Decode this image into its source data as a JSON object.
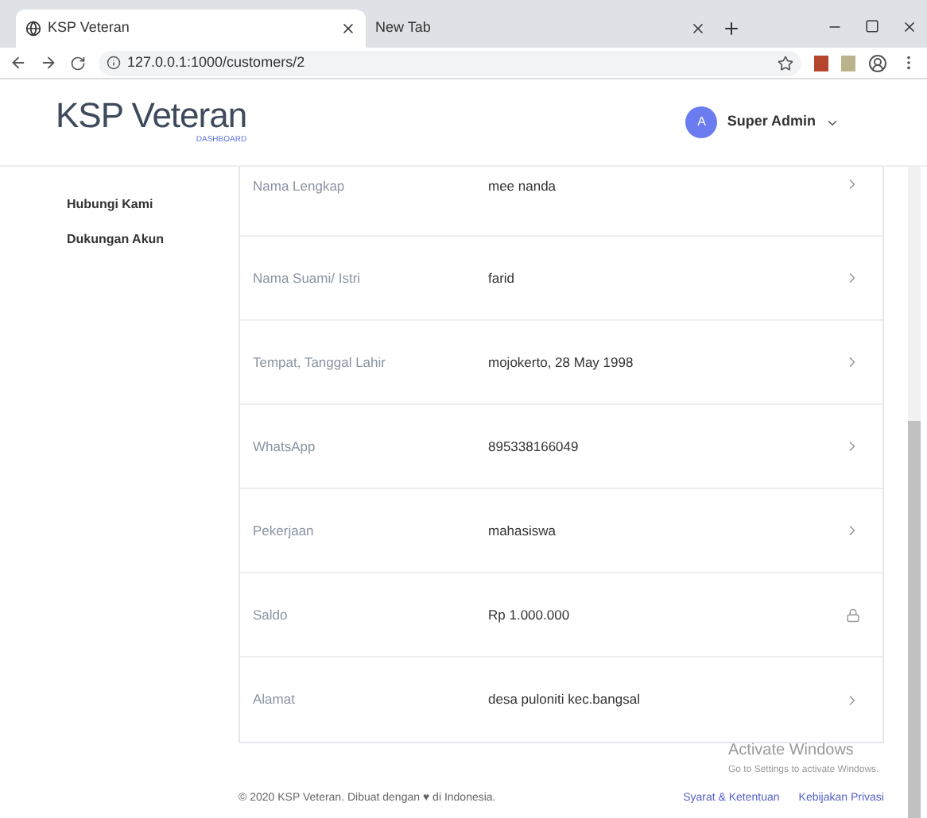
{
  "browser": {
    "tabs": [
      {
        "title": "KSP Veteran",
        "selected": true
      },
      {
        "title": "New Tab",
        "selected": false
      }
    ],
    "address": "127.0.0.1:1000/customers/2"
  },
  "header": {
    "brand": "KSP Veteran",
    "subtitle": "DASHBOARD",
    "avatar_letter": "A",
    "user": "Super Admin"
  },
  "sidebar": {
    "items": [
      "Hubungi Kami",
      "Dukungan Akun"
    ]
  },
  "details": [
    {
      "label": "Nama Lengkap",
      "value": "mee nanda",
      "kind": "chevron"
    },
    {
      "label": "Nama Suami/ Istri",
      "value": "farid",
      "kind": "chevron"
    },
    {
      "label": "Tempat, Tanggal Lahir",
      "value": "mojokerto, 28 May 1998",
      "kind": "chevron"
    },
    {
      "label": "WhatsApp",
      "value": "895338166049",
      "kind": "chevron"
    },
    {
      "label": "Pekerjaan",
      "value": "mahasiswa",
      "kind": "chevron"
    },
    {
      "label": "Saldo",
      "value": "Rp 1.000.000",
      "kind": "lock"
    },
    {
      "label": "Alamat",
      "value": "desa puloniti kec.bangsal",
      "kind": "chevron"
    }
  ],
  "footer": {
    "copyright": "© 2020 KSP Veteran. Dibuat dengan ♥ di Indonesia.",
    "links": [
      "Syarat & Ketentuan",
      "Kebijakan Privasi"
    ]
  },
  "os_notice": {
    "title": "Activate Windows",
    "text": "Go to Settings to activate Windows."
  }
}
